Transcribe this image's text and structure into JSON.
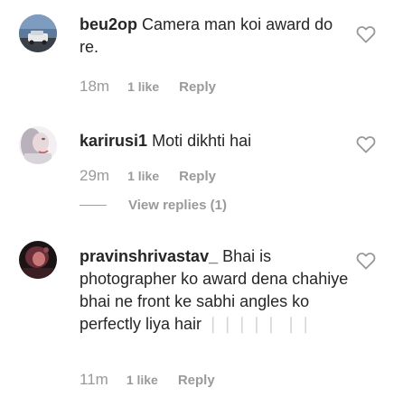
{
  "comments": [
    {
      "username": "beu2op",
      "text": "Camera man koi award do re.",
      "faint": "",
      "time": "18m",
      "likes": "1 like",
      "reply": "Reply"
    },
    {
      "username": "karirusi1",
      "text": "Moti dikhti hai",
      "faint": "",
      "time": "29m",
      "likes": "1 like",
      "reply": "Reply",
      "view_replies": "View replies (1)"
    },
    {
      "username": "pravinshrivastav_",
      "text": "Bhai is photographer ko award dena chahiye bhai ne front ke sabhi angles ko perfectly liya hair",
      "faint": "❘❘❘❘❘ ❘❘",
      "time": "11m",
      "likes": "1 like",
      "reply": "Reply"
    }
  ],
  "icons": {
    "like": "heart-outline-icon"
  },
  "colors": {
    "text": "#262626",
    "meta": "#9a9a9a",
    "heart_stroke": "#999999"
  }
}
